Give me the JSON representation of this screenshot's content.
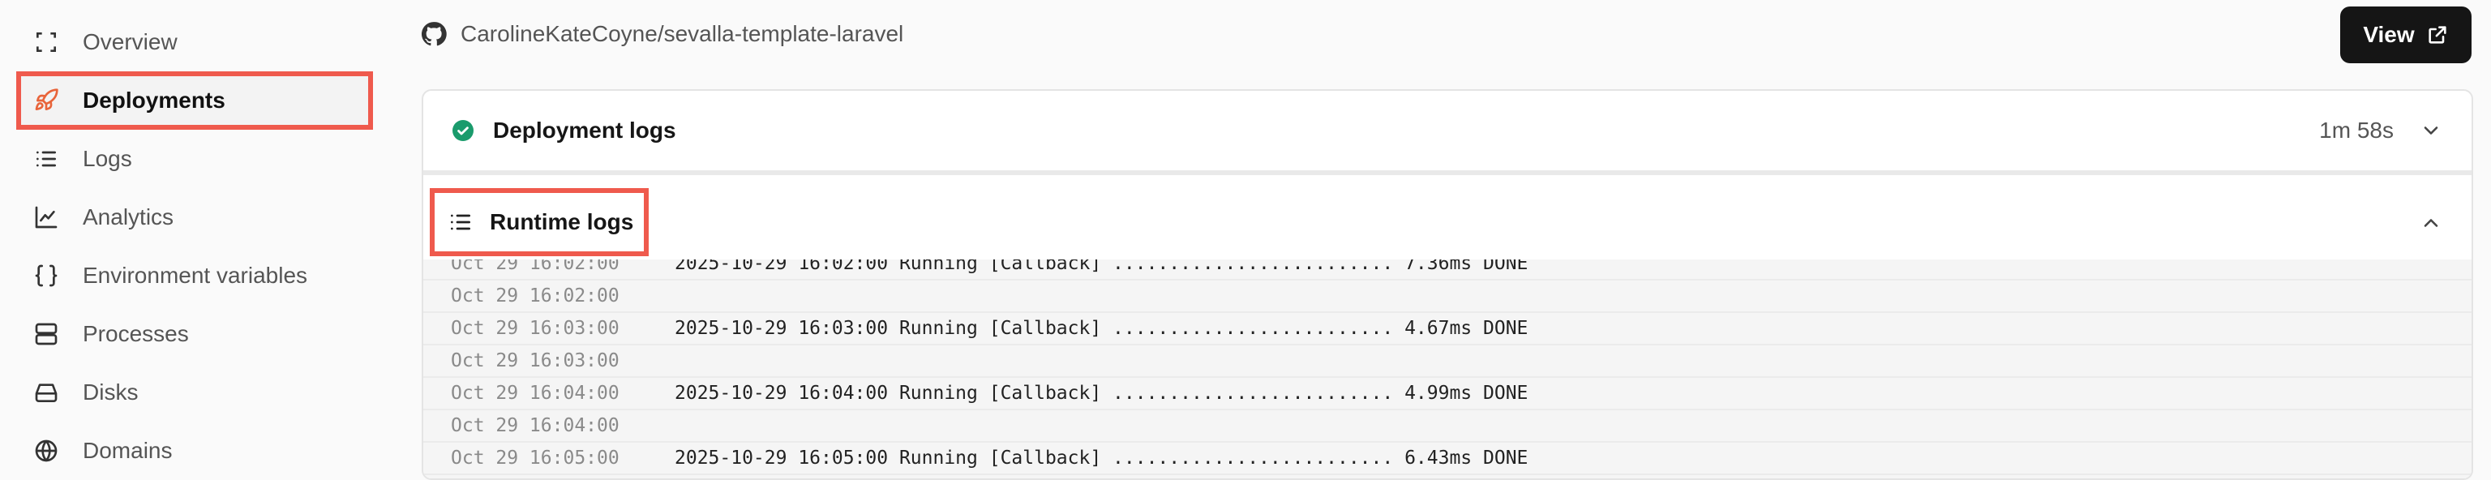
{
  "sidebar": {
    "items": [
      {
        "label": "Overview",
        "icon": "overview-icon"
      },
      {
        "label": "Deployments",
        "icon": "rocket-icon",
        "active": true
      },
      {
        "label": "Logs",
        "icon": "list-icon"
      },
      {
        "label": "Analytics",
        "icon": "chart-icon"
      },
      {
        "label": "Environment variables",
        "icon": "braces-icon"
      },
      {
        "label": "Processes",
        "icon": "server-icon"
      },
      {
        "label": "Disks",
        "icon": "disk-icon"
      },
      {
        "label": "Domains",
        "icon": "globe-icon"
      }
    ]
  },
  "header": {
    "repo": "CarolineKateCoyne/sevalla-template-laravel",
    "view_label": "View"
  },
  "deployment_logs": {
    "title": "Deployment logs",
    "duration": "1m 58s"
  },
  "runtime_logs": {
    "title": "Runtime logs",
    "lines": [
      {
        "ts": "Oct 29 16:02:00",
        "msg": "2025-10-29 16:02:00 Running [Callback] ......................... 7.36ms DONE"
      },
      {
        "ts": "Oct 29 16:02:00",
        "msg": ""
      },
      {
        "ts": "Oct 29 16:03:00",
        "msg": "2025-10-29 16:03:00 Running [Callback] ......................... 4.67ms DONE"
      },
      {
        "ts": "Oct 29 16:03:00",
        "msg": ""
      },
      {
        "ts": "Oct 29 16:04:00",
        "msg": "2025-10-29 16:04:00 Running [Callback] ......................... 4.99ms DONE"
      },
      {
        "ts": "Oct 29 16:04:00",
        "msg": ""
      },
      {
        "ts": "Oct 29 16:05:00",
        "msg": "2025-10-29 16:05:00 Running [Callback] ......................... 6.43ms DONE"
      }
    ]
  },
  "colors": {
    "highlight": "#ef5a4d",
    "success": "#1a9b6c",
    "accent_active": "#e8643a"
  }
}
